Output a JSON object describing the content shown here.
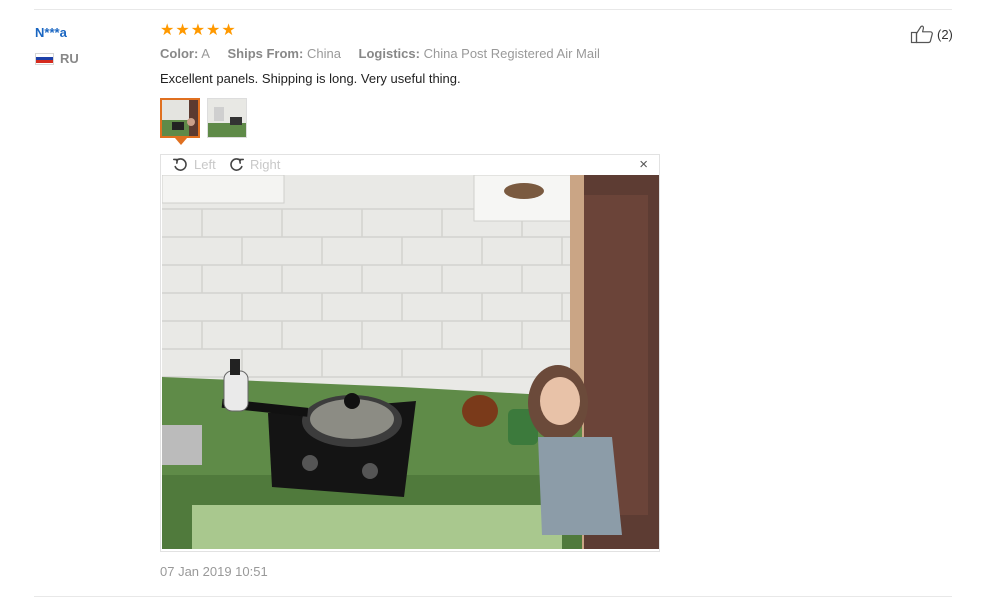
{
  "review": {
    "user_name": "N***a",
    "country_code": "RU",
    "rating": 5,
    "color_label": "Color:",
    "color_value": "A",
    "ships_from_label": "Ships From:",
    "ships_from_value": "China",
    "logistics_label": "Logistics:",
    "logistics_value": "China Post Registered Air Mail",
    "text": "Excellent panels. Shipping is long. Very useful thing.",
    "date": "07 Jan 2019 10:51",
    "helpful_count": "(2)"
  },
  "viewer": {
    "rotate_left_label": "Left",
    "rotate_right_label": "Right",
    "close_label": "×",
    "thumbnail_count": 2,
    "active_thumbnail": 1
  },
  "colors": {
    "username": "#1a66c2",
    "star": "#ff9900",
    "thumbnail_active_border": "#e07020",
    "muted_text": "#999999",
    "flag": [
      "#ffffff",
      "#1c3fa8",
      "#d52b1e"
    ]
  },
  "icons": {
    "star": "star-icon",
    "flag": "flag-ru-icon",
    "rotate_left": "rotate-left-icon",
    "rotate_right": "rotate-right-icon",
    "close": "close-icon",
    "like": "thumbs-up-icon"
  }
}
